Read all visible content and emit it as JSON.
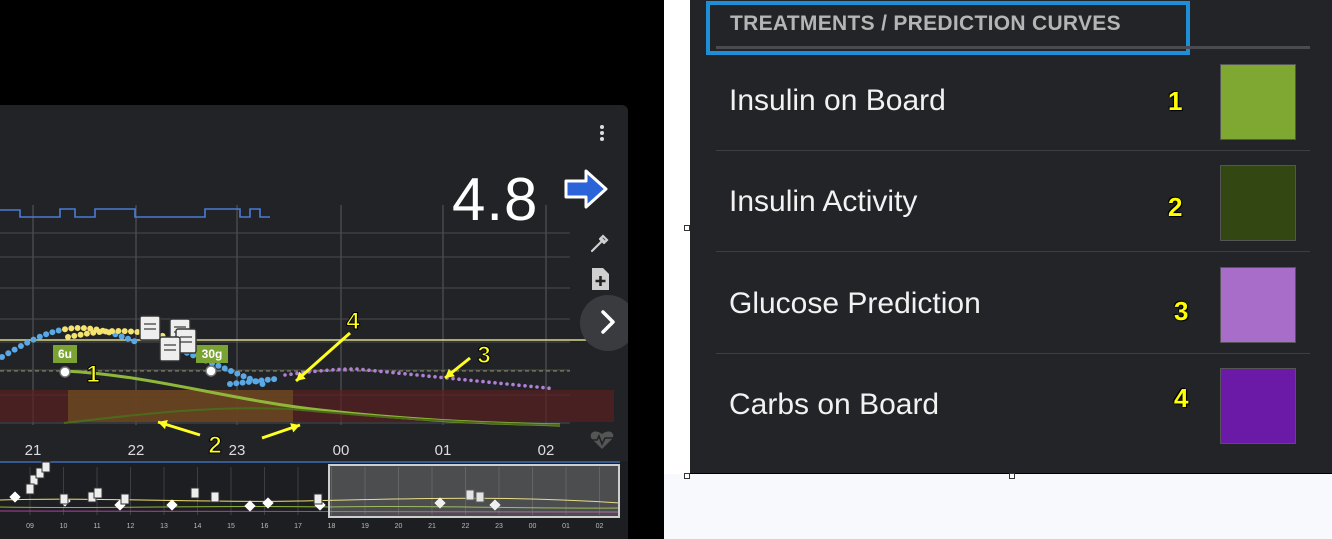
{
  "panel": {
    "title": "TREATMENTS / PREDICTION CURVES",
    "items": [
      {
        "label": "Insulin on Board",
        "number": "1",
        "color": "#7fa832"
      },
      {
        "label": "Insulin Activity",
        "number": "2",
        "color": "#334712"
      },
      {
        "label": "Glucose Prediction",
        "number": "3",
        "color": "#a86cc9"
      },
      {
        "label": "Carbs on Board",
        "number": "4",
        "color": "#6a1aa6"
      }
    ]
  },
  "chart": {
    "bg_value": "4.8",
    "time_labels": [
      "21",
      "22",
      "23",
      "00",
      "01",
      "02"
    ],
    "mini_time_labels": [
      "09",
      "10",
      "11",
      "12",
      "13",
      "14",
      "15",
      "16",
      "17",
      "18",
      "19",
      "20",
      "21",
      "22",
      "23",
      "00",
      "01",
      "02"
    ],
    "bolus_badge": "6u",
    "carbs_badge": "30g",
    "annotations": [
      "1",
      "2",
      "3",
      "4"
    ],
    "colors": {
      "bg_dots": "#5aa9e6",
      "high_dots": "#f4e36e",
      "iob": "#8fb83a",
      "activity": "#4d6a1c",
      "prediction": "#b07fd6",
      "cob": "#7a4a9a",
      "basal": "#4a7bd4"
    }
  }
}
